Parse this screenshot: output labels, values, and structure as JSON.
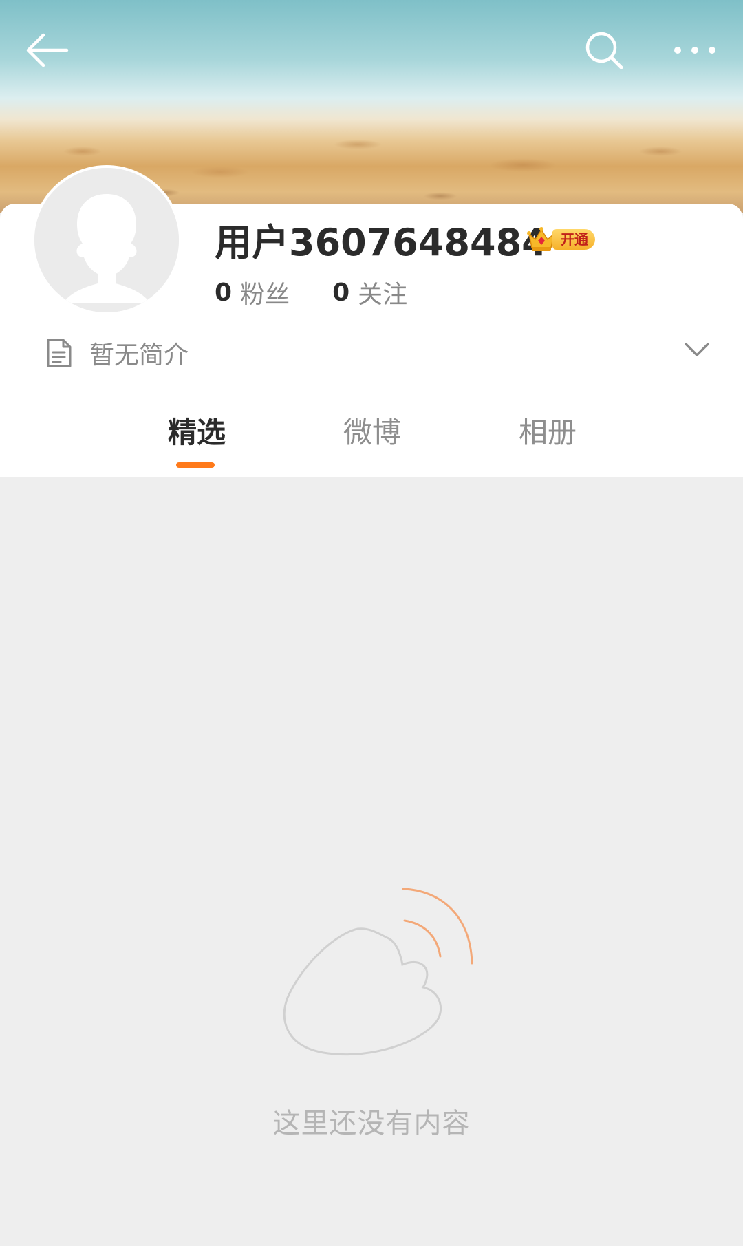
{
  "header": {
    "back_icon": "arrow-left-icon",
    "search_icon": "search-icon",
    "more_icon": "more-dots-icon"
  },
  "profile": {
    "username": "用户3607648484",
    "vip_badge": "开通",
    "followers_count": "0",
    "followers_label": "粉丝",
    "following_count": "0",
    "following_label": "关注",
    "bio": "暂无简介"
  },
  "tabs": [
    {
      "label": "精选",
      "active": true
    },
    {
      "label": "微博",
      "active": false
    },
    {
      "label": "相册",
      "active": false
    }
  ],
  "empty_state": {
    "message": "这里还没有内容"
  },
  "colors": {
    "accent": "#ff7a1a",
    "background": "#eeeeee"
  }
}
